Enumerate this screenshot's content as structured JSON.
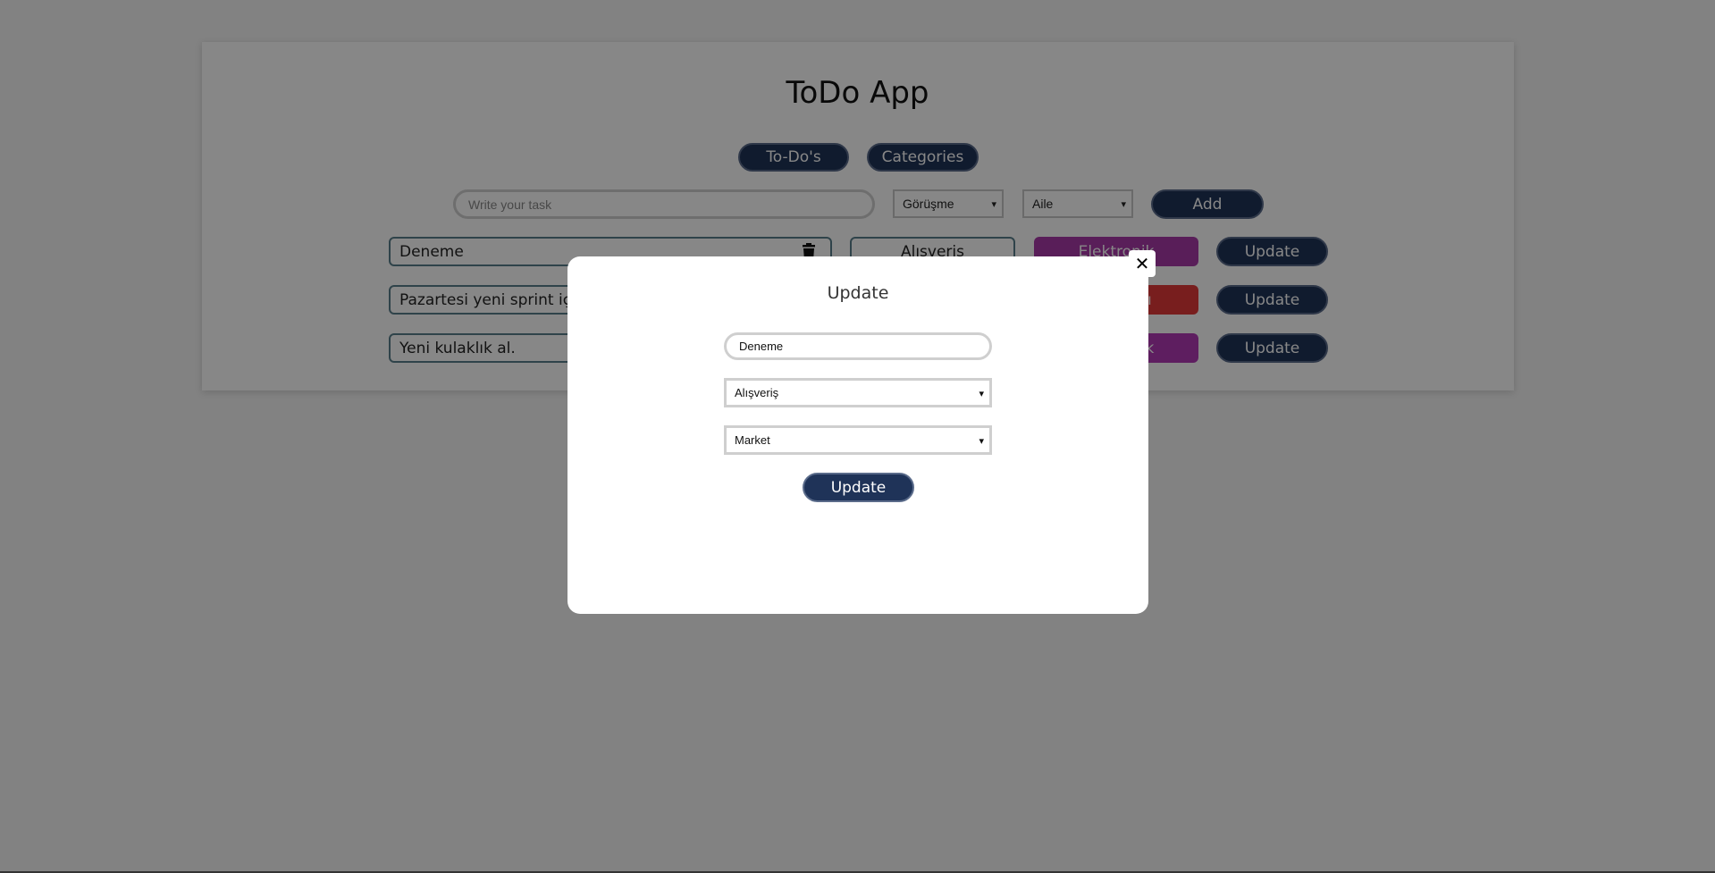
{
  "app": {
    "title": "ToDo App"
  },
  "nav": {
    "todos_label": "To-Do's",
    "categories_label": "Categories"
  },
  "add_form": {
    "task_placeholder": "Write your task",
    "category_selected": "Görüşme",
    "subcategory_selected": "Aile",
    "add_label": "Add"
  },
  "todos": [
    {
      "text": "Deneme",
      "category": "Alışveriş",
      "tag": "Elektronik",
      "tag_color": "#a93aa9",
      "update_label": "Update"
    },
    {
      "text": "Pazartesi yeni sprint için",
      "category": "",
      "tag": "Toplantısı",
      "tag_color": "#e23a3a",
      "update_label": "Update"
    },
    {
      "text": "Yeni kulaklık al.",
      "category": "",
      "tag": "Elektronik",
      "tag_color": "#b23ab5",
      "update_label": "Update"
    }
  ],
  "modal": {
    "title": "Update",
    "task_value": "Deneme",
    "category_selected": "Alışveriş",
    "subcategory_selected": "Market",
    "submit_label": "Update",
    "close_glyph": "✕"
  },
  "colors": {
    "primary": "#1f3358",
    "overlay": "rgba(0,0,0,0.47)"
  }
}
